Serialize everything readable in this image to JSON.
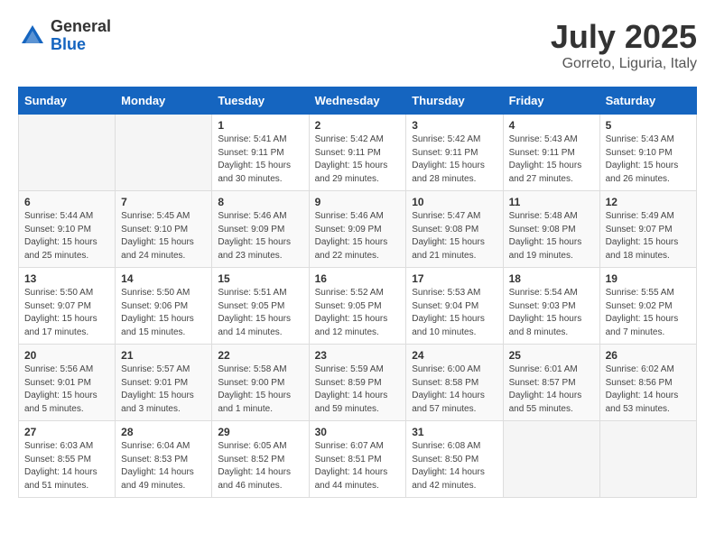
{
  "header": {
    "logo_general": "General",
    "logo_blue": "Blue",
    "month_title": "July 2025",
    "location": "Gorreto, Liguria, Italy"
  },
  "calendar": {
    "days_of_week": [
      "Sunday",
      "Monday",
      "Tuesday",
      "Wednesday",
      "Thursday",
      "Friday",
      "Saturday"
    ],
    "weeks": [
      [
        {
          "day": "",
          "info": ""
        },
        {
          "day": "",
          "info": ""
        },
        {
          "day": "1",
          "info": "Sunrise: 5:41 AM\nSunset: 9:11 PM\nDaylight: 15 hours\nand 30 minutes."
        },
        {
          "day": "2",
          "info": "Sunrise: 5:42 AM\nSunset: 9:11 PM\nDaylight: 15 hours\nand 29 minutes."
        },
        {
          "day": "3",
          "info": "Sunrise: 5:42 AM\nSunset: 9:11 PM\nDaylight: 15 hours\nand 28 minutes."
        },
        {
          "day": "4",
          "info": "Sunrise: 5:43 AM\nSunset: 9:11 PM\nDaylight: 15 hours\nand 27 minutes."
        },
        {
          "day": "5",
          "info": "Sunrise: 5:43 AM\nSunset: 9:10 PM\nDaylight: 15 hours\nand 26 minutes."
        }
      ],
      [
        {
          "day": "6",
          "info": "Sunrise: 5:44 AM\nSunset: 9:10 PM\nDaylight: 15 hours\nand 25 minutes."
        },
        {
          "day": "7",
          "info": "Sunrise: 5:45 AM\nSunset: 9:10 PM\nDaylight: 15 hours\nand 24 minutes."
        },
        {
          "day": "8",
          "info": "Sunrise: 5:46 AM\nSunset: 9:09 PM\nDaylight: 15 hours\nand 23 minutes."
        },
        {
          "day": "9",
          "info": "Sunrise: 5:46 AM\nSunset: 9:09 PM\nDaylight: 15 hours\nand 22 minutes."
        },
        {
          "day": "10",
          "info": "Sunrise: 5:47 AM\nSunset: 9:08 PM\nDaylight: 15 hours\nand 21 minutes."
        },
        {
          "day": "11",
          "info": "Sunrise: 5:48 AM\nSunset: 9:08 PM\nDaylight: 15 hours\nand 19 minutes."
        },
        {
          "day": "12",
          "info": "Sunrise: 5:49 AM\nSunset: 9:07 PM\nDaylight: 15 hours\nand 18 minutes."
        }
      ],
      [
        {
          "day": "13",
          "info": "Sunrise: 5:50 AM\nSunset: 9:07 PM\nDaylight: 15 hours\nand 17 minutes."
        },
        {
          "day": "14",
          "info": "Sunrise: 5:50 AM\nSunset: 9:06 PM\nDaylight: 15 hours\nand 15 minutes."
        },
        {
          "day": "15",
          "info": "Sunrise: 5:51 AM\nSunset: 9:05 PM\nDaylight: 15 hours\nand 14 minutes."
        },
        {
          "day": "16",
          "info": "Sunrise: 5:52 AM\nSunset: 9:05 PM\nDaylight: 15 hours\nand 12 minutes."
        },
        {
          "day": "17",
          "info": "Sunrise: 5:53 AM\nSunset: 9:04 PM\nDaylight: 15 hours\nand 10 minutes."
        },
        {
          "day": "18",
          "info": "Sunrise: 5:54 AM\nSunset: 9:03 PM\nDaylight: 15 hours\nand 8 minutes."
        },
        {
          "day": "19",
          "info": "Sunrise: 5:55 AM\nSunset: 9:02 PM\nDaylight: 15 hours\nand 7 minutes."
        }
      ],
      [
        {
          "day": "20",
          "info": "Sunrise: 5:56 AM\nSunset: 9:01 PM\nDaylight: 15 hours\nand 5 minutes."
        },
        {
          "day": "21",
          "info": "Sunrise: 5:57 AM\nSunset: 9:01 PM\nDaylight: 15 hours\nand 3 minutes."
        },
        {
          "day": "22",
          "info": "Sunrise: 5:58 AM\nSunset: 9:00 PM\nDaylight: 15 hours\nand 1 minute."
        },
        {
          "day": "23",
          "info": "Sunrise: 5:59 AM\nSunset: 8:59 PM\nDaylight: 14 hours\nand 59 minutes."
        },
        {
          "day": "24",
          "info": "Sunrise: 6:00 AM\nSunset: 8:58 PM\nDaylight: 14 hours\nand 57 minutes."
        },
        {
          "day": "25",
          "info": "Sunrise: 6:01 AM\nSunset: 8:57 PM\nDaylight: 14 hours\nand 55 minutes."
        },
        {
          "day": "26",
          "info": "Sunrise: 6:02 AM\nSunset: 8:56 PM\nDaylight: 14 hours\nand 53 minutes."
        }
      ],
      [
        {
          "day": "27",
          "info": "Sunrise: 6:03 AM\nSunset: 8:55 PM\nDaylight: 14 hours\nand 51 minutes."
        },
        {
          "day": "28",
          "info": "Sunrise: 6:04 AM\nSunset: 8:53 PM\nDaylight: 14 hours\nand 49 minutes."
        },
        {
          "day": "29",
          "info": "Sunrise: 6:05 AM\nSunset: 8:52 PM\nDaylight: 14 hours\nand 46 minutes."
        },
        {
          "day": "30",
          "info": "Sunrise: 6:07 AM\nSunset: 8:51 PM\nDaylight: 14 hours\nand 44 minutes."
        },
        {
          "day": "31",
          "info": "Sunrise: 6:08 AM\nSunset: 8:50 PM\nDaylight: 14 hours\nand 42 minutes."
        },
        {
          "day": "",
          "info": ""
        },
        {
          "day": "",
          "info": ""
        }
      ]
    ]
  }
}
